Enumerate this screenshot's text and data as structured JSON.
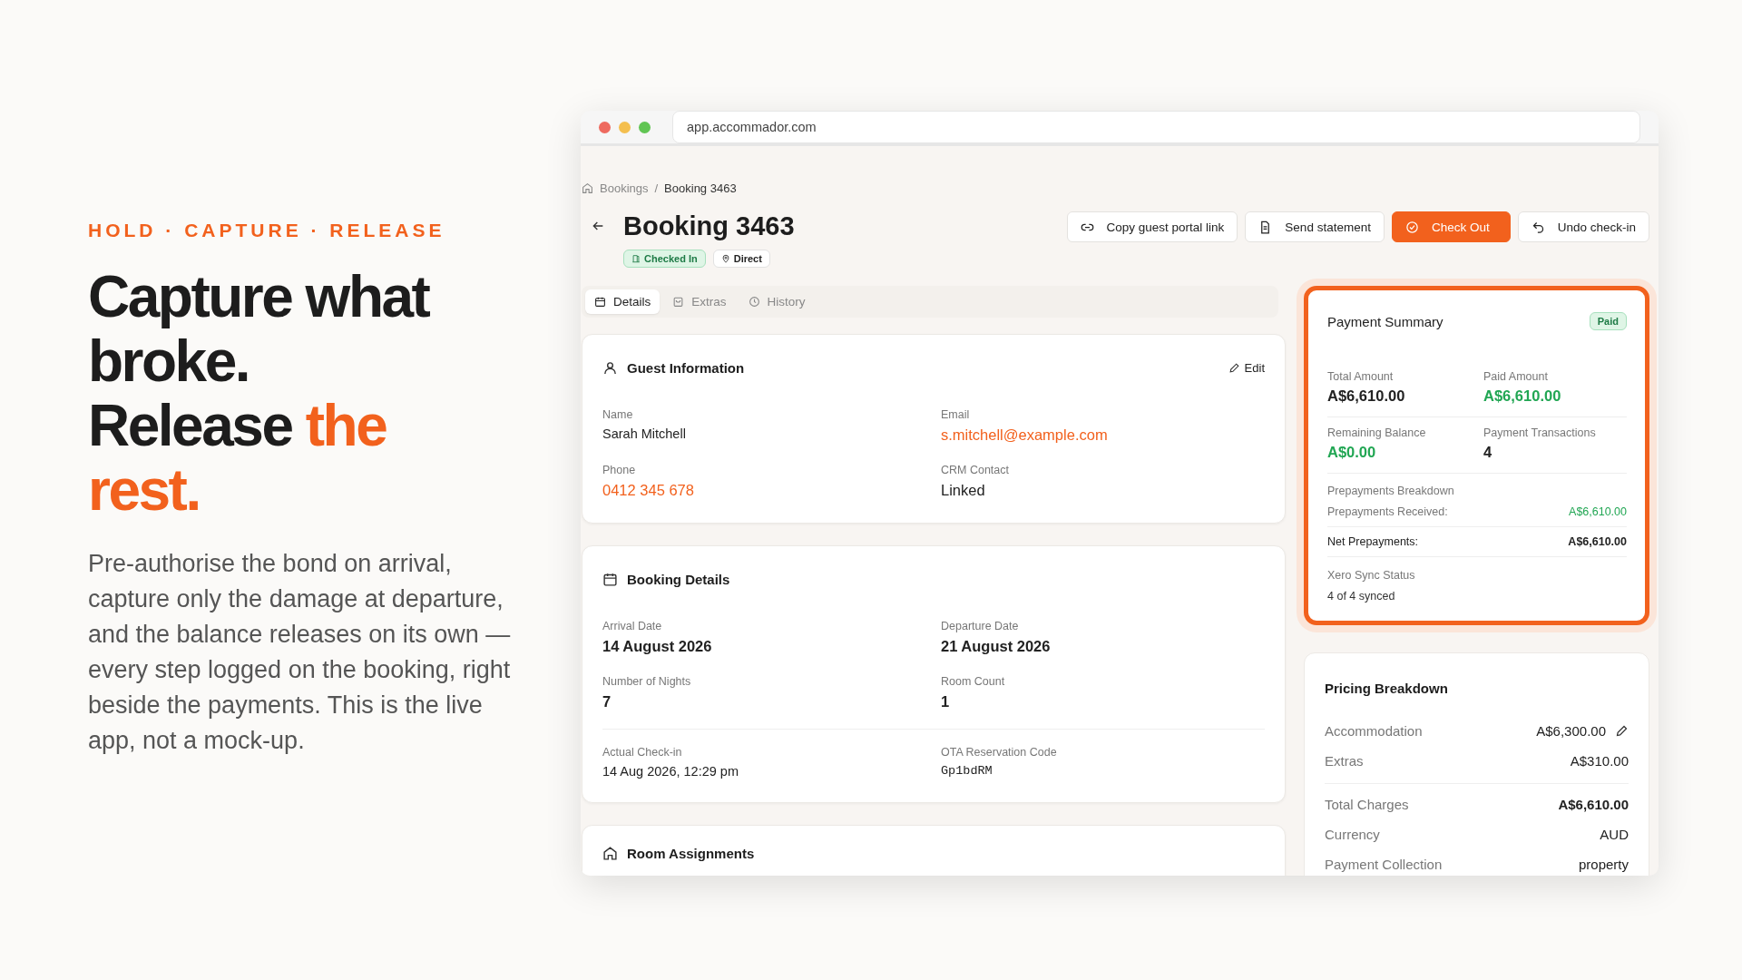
{
  "eyebrow": "HOLD · CAPTURE · RELEASE",
  "headline": [
    {
      "text": "Capture what broke.",
      "accent": false
    },
    {
      "text": "Release",
      "accent": false
    },
    {
      "text": "the rest.",
      "accent": true
    }
  ],
  "description": "Pre-authorise the bond on arrival, capture only the damage at departure, and the balance releases on its own — every step logged on the booking, right beside the payments. This is the live app, not a mock-up.",
  "browser": {
    "url": "app.accommador.com"
  },
  "breadcrumb": [
    "Bookings",
    "Booking 3463"
  ],
  "breadcrumb_separator": "/",
  "title": "Booking 3463",
  "badges": [
    {
      "label": "Checked In",
      "kind": "status"
    },
    {
      "label": "Direct",
      "kind": "source"
    }
  ],
  "actions": [
    {
      "label": "Copy guest portal link",
      "kind": "outline"
    },
    {
      "label": "Send statement",
      "kind": "outline"
    },
    {
      "label": "Check Out",
      "kind": "primary"
    },
    {
      "label": "Undo check-in",
      "kind": "outline"
    }
  ],
  "tabs": [
    {
      "label": "Details",
      "selected": true
    },
    {
      "label": "Extras",
      "selected": false
    },
    {
      "label": "History",
      "selected": false
    }
  ],
  "guest_information": {
    "title": "Guest Information",
    "edit": "Edit",
    "fields": [
      {
        "label": "Name",
        "value": "Sarah Mitchell",
        "kind": "plain"
      },
      {
        "label": "Email",
        "value": "s.mitchell@example.com",
        "kind": "link"
      },
      {
        "label": "Phone",
        "value": "0412 345 678",
        "kind": "link"
      },
      {
        "label": "CRM Contact",
        "value": "Linked",
        "kind": "large"
      }
    ]
  },
  "booking_details": {
    "title": "Booking Details",
    "fields": [
      {
        "label": "Arrival Date",
        "value": "14 August 2026",
        "kind": "strong"
      },
      {
        "label": "Departure Date",
        "value": "21 August 2026",
        "kind": "strong"
      },
      {
        "label": "Number of Nights",
        "value": "7",
        "kind": "strong"
      },
      {
        "label": "Room Count",
        "value": "1",
        "kind": "strong"
      }
    ],
    "extra_fields": [
      {
        "label": "Actual Check-in",
        "value": "14 Aug 2026, 12:29 pm",
        "kind": "plain"
      },
      {
        "label": "OTA Reservation Code",
        "value": "Gp1bdRM",
        "kind": "mono"
      }
    ]
  },
  "room_assignments": {
    "title": "Room Assignments"
  },
  "payment_summary": {
    "title": "Payment Summary",
    "status": "Paid",
    "highlighted": true,
    "stats": [
      {
        "label": "Total Amount",
        "value": "A$6,610.00",
        "positive": false
      },
      {
        "label": "Paid Amount",
        "value": "A$6,610.00",
        "positive": true
      },
      {
        "label": "Remaining Balance",
        "value": "A$0.00",
        "positive": true
      },
      {
        "label": "Payment Transactions",
        "value": "4",
        "positive": false
      }
    ],
    "breakdown_title": "Prepayments Breakdown",
    "breakdown": [
      {
        "label": "Prepayments Received:",
        "value": "A$6,610.00",
        "kind": "received"
      },
      {
        "label": "Net Prepayments:",
        "value": "A$6,610.00",
        "kind": "net"
      }
    ],
    "sync_label": "Xero Sync Status",
    "sync_value": "4 of 4 synced"
  },
  "pricing_breakdown": {
    "title": "Pricing Breakdown",
    "rows": [
      {
        "label": "Accommodation",
        "value": "A$6,300.00",
        "kind": "editable"
      },
      {
        "label": "Extras",
        "value": "A$310.00",
        "kind": "plain"
      },
      {
        "label": "Total Charges",
        "value": "A$6,610.00",
        "kind": "total"
      },
      {
        "label": "Currency",
        "value": "AUD",
        "kind": "plain"
      },
      {
        "label": "Payment Collection",
        "value": "property",
        "kind": "plain"
      }
    ]
  }
}
